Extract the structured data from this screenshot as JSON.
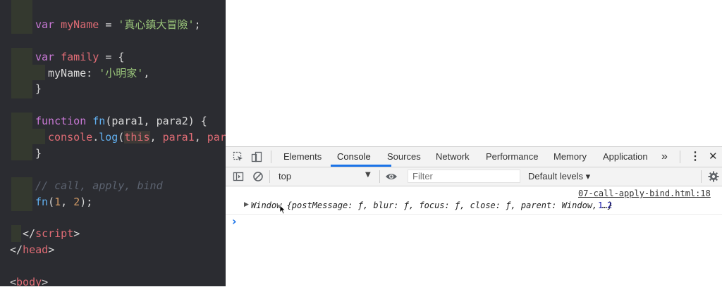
{
  "editor": {
    "lines": {
      "l1": {
        "kw": "var",
        "name": "myName",
        "eq": " = ",
        "str": "'真心鎮大冒險'",
        "end": ";"
      },
      "l2": {
        "kw": "var",
        "name": "family",
        "rest": " = {"
      },
      "l3": {
        "key": "myName:",
        "str": "'小明家'",
        "end": ","
      },
      "l4": {
        "text": "}"
      },
      "l5": {
        "kw": "function",
        "name": "fn",
        "params": "(para1, para2) {"
      },
      "l6": {
        "obj": "console",
        "dot": ".",
        "method": "log",
        "open": "(",
        "this": "this",
        "comma1": ", ",
        "p1": "para1",
        "comma2": ", ",
        "p2": "par"
      },
      "l7": {
        "text": "}"
      },
      "l8": {
        "comment": "// call, apply, bind"
      },
      "l9": {
        "name": "fn",
        "open": "(",
        "a": "1",
        "sep": ", ",
        "b": "2",
        "close": ");"
      },
      "l10": {
        "lt": "</",
        "tag": "script",
        "gt": ">"
      },
      "l11": {
        "lt": "</",
        "tag": "head",
        "gt": ">"
      },
      "l12": {
        "lt": "<",
        "tag": "body",
        "gt": ">"
      }
    }
  },
  "devtools": {
    "tabs": [
      "Elements",
      "Console",
      "Sources",
      "Network",
      "Performance",
      "Memory",
      "Application"
    ],
    "active_tab": "Console",
    "more_tabs": "»",
    "kebab": "⋮",
    "close": "✕",
    "context": "top",
    "filter_placeholder": "Filter",
    "levels": "Default levels ▾",
    "accent_color": "#1a73e8"
  },
  "console": {
    "source_link": "07-call-apply-bind.html:18",
    "expand_arrow": "▶",
    "log_object": "Window {postMessage: ƒ, blur: ƒ, focus: ƒ, close: ƒ, parent: Window, …}",
    "arg1": "1",
    "arg2": "2",
    "prompt": "›"
  }
}
